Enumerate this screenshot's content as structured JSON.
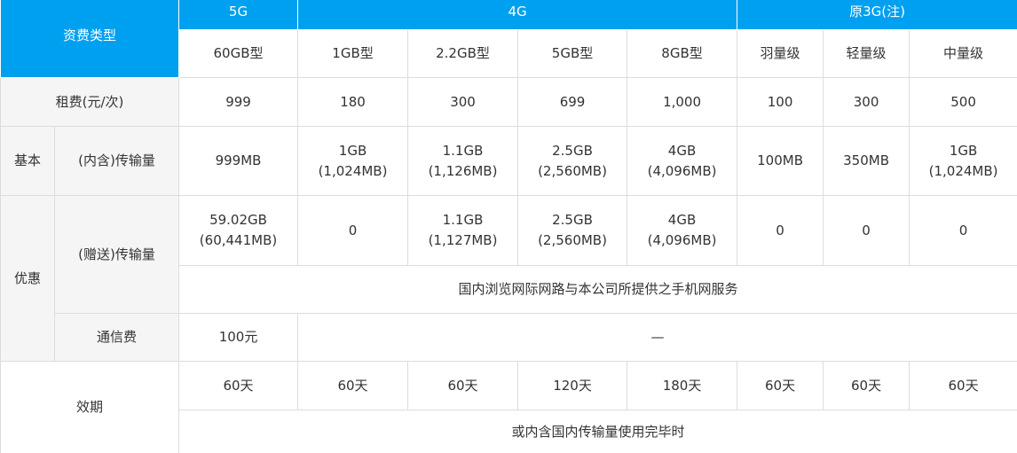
{
  "header": {
    "tariff_type": "资费类型",
    "groups": [
      "5G",
      "4G",
      "原3G(注)"
    ],
    "plans": [
      "60GB型",
      "1GB型",
      "2.2GB型",
      "5GB型",
      "8GB型",
      "羽量级",
      "轻量级",
      "中量级"
    ]
  },
  "rent": {
    "label": "租费(元/次)",
    "values": [
      "999",
      "180",
      "300",
      "699",
      "1,000",
      "100",
      "300",
      "500"
    ]
  },
  "basic": {
    "section_label": "基本",
    "label": "(内含)传输量",
    "values": [
      [
        "999MB"
      ],
      [
        "1GB",
        "(1,024MB)"
      ],
      [
        "1.1GB",
        "(1,126MB)"
      ],
      [
        "2.5GB",
        "(2,560MB)"
      ],
      [
        "4GB",
        "(4,096MB)"
      ],
      [
        "100MB"
      ],
      [
        "350MB"
      ],
      [
        "1GB",
        "(1,024MB)"
      ]
    ]
  },
  "bonus": {
    "section_label": "优惠",
    "label": "(赠送)传输量",
    "values": [
      [
        "59.02GB",
        "(60,441MB)"
      ],
      [
        "0"
      ],
      [
        "1.1GB",
        "(1,127MB)"
      ],
      [
        "2.5GB",
        "(2,560MB)"
      ],
      [
        "4GB",
        "(4,096MB)"
      ],
      [
        "0"
      ],
      [
        "0"
      ],
      [
        "0"
      ]
    ],
    "scope_note": "国内浏览网际网路与本公司所提供之手机网服务"
  },
  "call_fee": {
    "label": "通信费",
    "value_5g": "100元",
    "value_others": "—"
  },
  "validity": {
    "label": "效期",
    "values": [
      "60天",
      "60天",
      "60天",
      "120天",
      "180天",
      "60天",
      "60天",
      "60天"
    ],
    "note": "或内含国内传输量使用完毕时"
  }
}
